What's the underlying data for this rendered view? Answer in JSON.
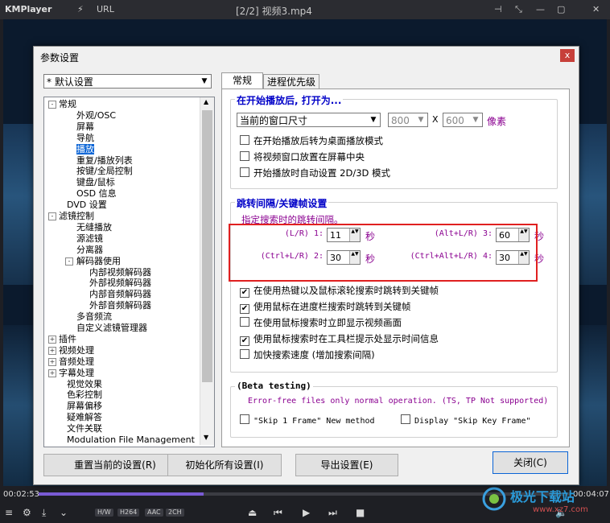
{
  "player": {
    "logo": "KMPlayer",
    "url_label": "URL",
    "title": "[2/2] 视频3.mp4",
    "time_elapsed": "00:02:53",
    "time_total": "00:04:07",
    "progress": 0.31,
    "badges": [
      "H/W",
      "H264",
      "AAC",
      "2CH"
    ],
    "watermark": "极光下载站",
    "watermark_url": "www.xz7.com"
  },
  "dialog": {
    "title": "参数设置",
    "close_glyph": "x",
    "preset": "* 默认设置",
    "tabs": [
      "常规",
      "进程优先级"
    ],
    "tree": [
      {
        "label": "常规",
        "level": 0,
        "exp": "-"
      },
      {
        "label": "外观/OSC",
        "level": 2
      },
      {
        "label": "屏幕",
        "level": 2
      },
      {
        "label": "导航",
        "level": 2
      },
      {
        "label": "播放",
        "level": 2,
        "selected": true
      },
      {
        "label": "重复/播放列表",
        "level": 2
      },
      {
        "label": "按键/全局控制",
        "level": 2
      },
      {
        "label": "键盘/鼠标",
        "level": 2
      },
      {
        "label": "OSD 信息",
        "level": 2
      },
      {
        "label": "DVD 设置",
        "level": 1
      },
      {
        "label": "滤镜控制",
        "level": 0,
        "exp": "-"
      },
      {
        "label": "无缝播放",
        "level": 2
      },
      {
        "label": "源滤镜",
        "level": 2
      },
      {
        "label": "分离器",
        "level": 2
      },
      {
        "label": "解码器使用",
        "level": 2,
        "exp": "-"
      },
      {
        "label": "内部视频解码器",
        "level": 3
      },
      {
        "label": "外部视频解码器",
        "level": 3
      },
      {
        "label": "内部音频解码器",
        "level": 3
      },
      {
        "label": "外部音频解码器",
        "level": 3
      },
      {
        "label": "多音频流",
        "level": 2
      },
      {
        "label": "自定义滤镜管理器",
        "level": 2
      },
      {
        "label": "插件",
        "level": 0,
        "exp": "+"
      },
      {
        "label": "视频处理",
        "level": 0,
        "exp": "+"
      },
      {
        "label": "音频处理",
        "level": 0,
        "exp": "+"
      },
      {
        "label": "字幕处理",
        "level": 0,
        "exp": "+"
      },
      {
        "label": "视觉效果",
        "level": 1
      },
      {
        "label": "色彩控制",
        "level": 1
      },
      {
        "label": "屏幕偏移",
        "level": 1
      },
      {
        "label": "疑难解答",
        "level": 1
      },
      {
        "label": "文件关联",
        "level": 1
      },
      {
        "label": "Modulation File Management",
        "level": 1
      }
    ],
    "start_group": {
      "title": "在开始播放后, 打开为...",
      "window_size": "当前的窗口尺寸",
      "width": "800",
      "x": "X",
      "height": "600",
      "unit": "像素",
      "checks": [
        {
          "label": "在开始播放后转为桌面播放模式",
          "checked": false
        },
        {
          "label": "将视频窗口放置在屏幕中央",
          "checked": false
        },
        {
          "label": "开始播放时自动设置 2D/3D 模式",
          "checked": false
        }
      ]
    },
    "jump_group": {
      "title": "跳转间隔/关键帧设置",
      "hint": "指定搜索时的跳转间隔。",
      "intervals": [
        {
          "label": "(L/R) 1:",
          "value": "11",
          "unit": "秒"
        },
        {
          "label": "(Alt+L/R) 3:",
          "value": "60",
          "unit": "秒"
        },
        {
          "label": "(Ctrl+L/R) 2:",
          "value": "30",
          "unit": "秒"
        },
        {
          "label": "(Ctrl+Alt+L/R) 4:",
          "value": "30",
          "unit": "秒"
        }
      ],
      "checks": [
        {
          "label": "在使用热键以及鼠标滚轮搜索时跳转到关键帧",
          "checked": true
        },
        {
          "label": "使用鼠标在进度栏搜索时跳转到关键帧",
          "checked": true
        },
        {
          "label": "在使用鼠标搜索时立即显示视频画面",
          "checked": false
        },
        {
          "label": "使用鼠标搜索时在工具栏提示处显示时间信息",
          "checked": true
        },
        {
          "label": "加快搜索速度 (增加搜索间隔)",
          "checked": false
        }
      ]
    },
    "beta_group": {
      "title": "(Beta testing)",
      "note": "Error-free files only normal operation. (TS, TP Not supported)",
      "checks": [
        {
          "label": "\"Skip 1 Frame\" New method",
          "checked": false
        },
        {
          "label": "Display \"Skip Key Frame\"",
          "checked": false
        }
      ]
    },
    "buttons": {
      "reset": "重置当前的设置(R)",
      "init": "初始化所有设置(I)",
      "export": "导出设置(E)",
      "close": "关闭(C)"
    }
  }
}
